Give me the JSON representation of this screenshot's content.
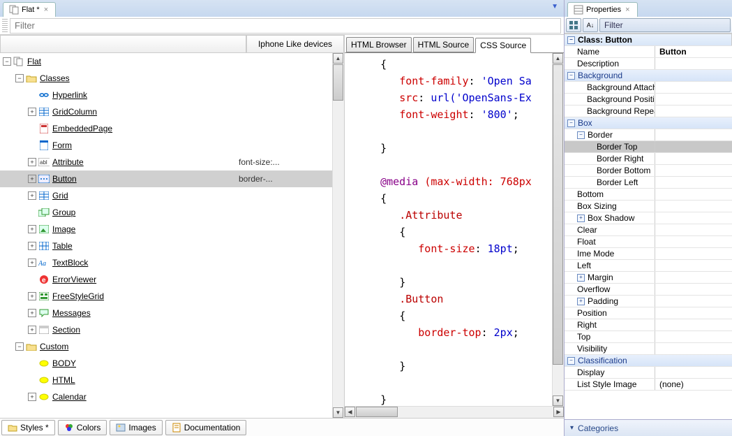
{
  "editor": {
    "tab_label": "Flat *",
    "properties_tab": "Properties",
    "filter_placeholder": "Filter",
    "tree_header_device": "Iphone Like devices",
    "code_tabs": {
      "html_browser": "HTML Browser",
      "html_source": "HTML Source",
      "css_source": "CSS Source"
    },
    "bottom_tabs": {
      "styles": "Styles *",
      "colors": "Colors",
      "images": "Images",
      "documentation": "Documentation"
    }
  },
  "tree": {
    "root": "Flat",
    "classes_label": "Classes",
    "custom_label": "Custom",
    "items": [
      {
        "name": "Hyperlink",
        "icon": "link"
      },
      {
        "name": "GridColumn",
        "icon": "grid",
        "exp": true
      },
      {
        "name": "EmbeddedPage",
        "icon": "page"
      },
      {
        "name": "Form",
        "icon": "form"
      },
      {
        "name": "Attribute",
        "icon": "abl",
        "exp": true,
        "device": "font-size:..."
      },
      {
        "name": "Button",
        "icon": "btn",
        "exp": true,
        "selected": true,
        "device": "border-..."
      },
      {
        "name": "Grid",
        "icon": "grid",
        "exp": true
      },
      {
        "name": "Group",
        "icon": "group"
      },
      {
        "name": "Image",
        "icon": "image",
        "exp": true
      },
      {
        "name": "Table",
        "icon": "table",
        "exp": true
      },
      {
        "name": "TextBlock",
        "icon": "text",
        "exp": true
      },
      {
        "name": "ErrorViewer",
        "icon": "error"
      },
      {
        "name": "FreeStyleGrid",
        "icon": "fgrid",
        "exp": true
      },
      {
        "name": "Messages",
        "icon": "msg",
        "exp": true
      },
      {
        "name": "Section",
        "icon": "section",
        "exp": true
      }
    ],
    "custom_items": [
      {
        "name": "BODY",
        "icon": "ring"
      },
      {
        "name": "HTML",
        "icon": "ring"
      },
      {
        "name": "Calendar",
        "icon": "ring",
        "exp": true
      }
    ]
  },
  "code": {
    "lines": [
      {
        "indent": 1,
        "brace": "{"
      },
      {
        "indent": 2,
        "prop": "font-family",
        "val": "'Open Sa"
      },
      {
        "indent": 2,
        "prop": "src",
        "val": "url('OpenSans-Ex"
      },
      {
        "indent": 2,
        "prop": "font-weight",
        "val": "'800'",
        "semi": true
      },
      {
        "blank": true
      },
      {
        "indent": 1,
        "brace": "}"
      },
      {
        "blank": true
      },
      {
        "indent": 1,
        "at": "@media",
        "atarg": "(max-width: 768px"
      },
      {
        "indent": 1,
        "brace": "{"
      },
      {
        "indent": 2,
        "sel": ".Attribute"
      },
      {
        "indent": 2,
        "brace": "{"
      },
      {
        "indent": 3,
        "prop": "font-size",
        "val": "18pt",
        "semi": true
      },
      {
        "blank": true
      },
      {
        "indent": 2,
        "brace": "}"
      },
      {
        "indent": 2,
        "sel": ".Button"
      },
      {
        "indent": 2,
        "brace": "{"
      },
      {
        "indent": 3,
        "prop": "border-top",
        "val": "2px",
        "semi": true
      },
      {
        "blank": true
      },
      {
        "indent": 2,
        "brace": "}"
      },
      {
        "blank": true
      },
      {
        "indent": 1,
        "brace": "}"
      }
    ]
  },
  "props": {
    "title": "Class: Button",
    "rows": [
      {
        "type": "row",
        "name": "Name",
        "val": "Button",
        "bold": true
      },
      {
        "type": "row",
        "name": "Description",
        "val": ""
      },
      {
        "type": "group",
        "name": "Background",
        "exp": "-"
      },
      {
        "type": "row",
        "name": "Background Attachme",
        "indent": 1
      },
      {
        "type": "row",
        "name": "Background Position",
        "indent": 1
      },
      {
        "type": "row",
        "name": "Background Repeat",
        "indent": 1
      },
      {
        "type": "group",
        "name": "Box",
        "exp": "-"
      },
      {
        "type": "subgroup",
        "name": "Border",
        "exp": "-",
        "indent": 1
      },
      {
        "type": "row",
        "name": "Border Top",
        "indent": 2,
        "selected": true
      },
      {
        "type": "row",
        "name": "Border Right",
        "indent": 2
      },
      {
        "type": "row",
        "name": "Border Bottom",
        "indent": 2
      },
      {
        "type": "row",
        "name": "Border Left",
        "indent": 2
      },
      {
        "type": "row",
        "name": "Bottom",
        "indent": 0
      },
      {
        "type": "row",
        "name": "Box Sizing",
        "indent": 0
      },
      {
        "type": "row",
        "name": "Box Shadow",
        "indent": 0,
        "exp": "+"
      },
      {
        "type": "row",
        "name": "Clear",
        "indent": 0
      },
      {
        "type": "row",
        "name": "Float",
        "indent": 0
      },
      {
        "type": "row",
        "name": "Ime Mode",
        "indent": 0
      },
      {
        "type": "row",
        "name": "Left",
        "indent": 0
      },
      {
        "type": "row",
        "name": "Margin",
        "indent": 0,
        "exp": "+"
      },
      {
        "type": "row",
        "name": "Overflow",
        "indent": 0
      },
      {
        "type": "row",
        "name": "Padding",
        "indent": 0,
        "exp": "+"
      },
      {
        "type": "row",
        "name": "Position",
        "indent": 0
      },
      {
        "type": "row",
        "name": "Right",
        "indent": 0
      },
      {
        "type": "row",
        "name": "Top",
        "indent": 0
      },
      {
        "type": "row",
        "name": "Visibility",
        "indent": 0
      },
      {
        "type": "group",
        "name": "Classification",
        "exp": "-"
      },
      {
        "type": "row",
        "name": "Display",
        "indent": 0
      },
      {
        "type": "row",
        "name": "List Style Image",
        "indent": 0,
        "val": "(none)"
      }
    ],
    "categories_label": "Categories",
    "filter_label": "Filter"
  }
}
